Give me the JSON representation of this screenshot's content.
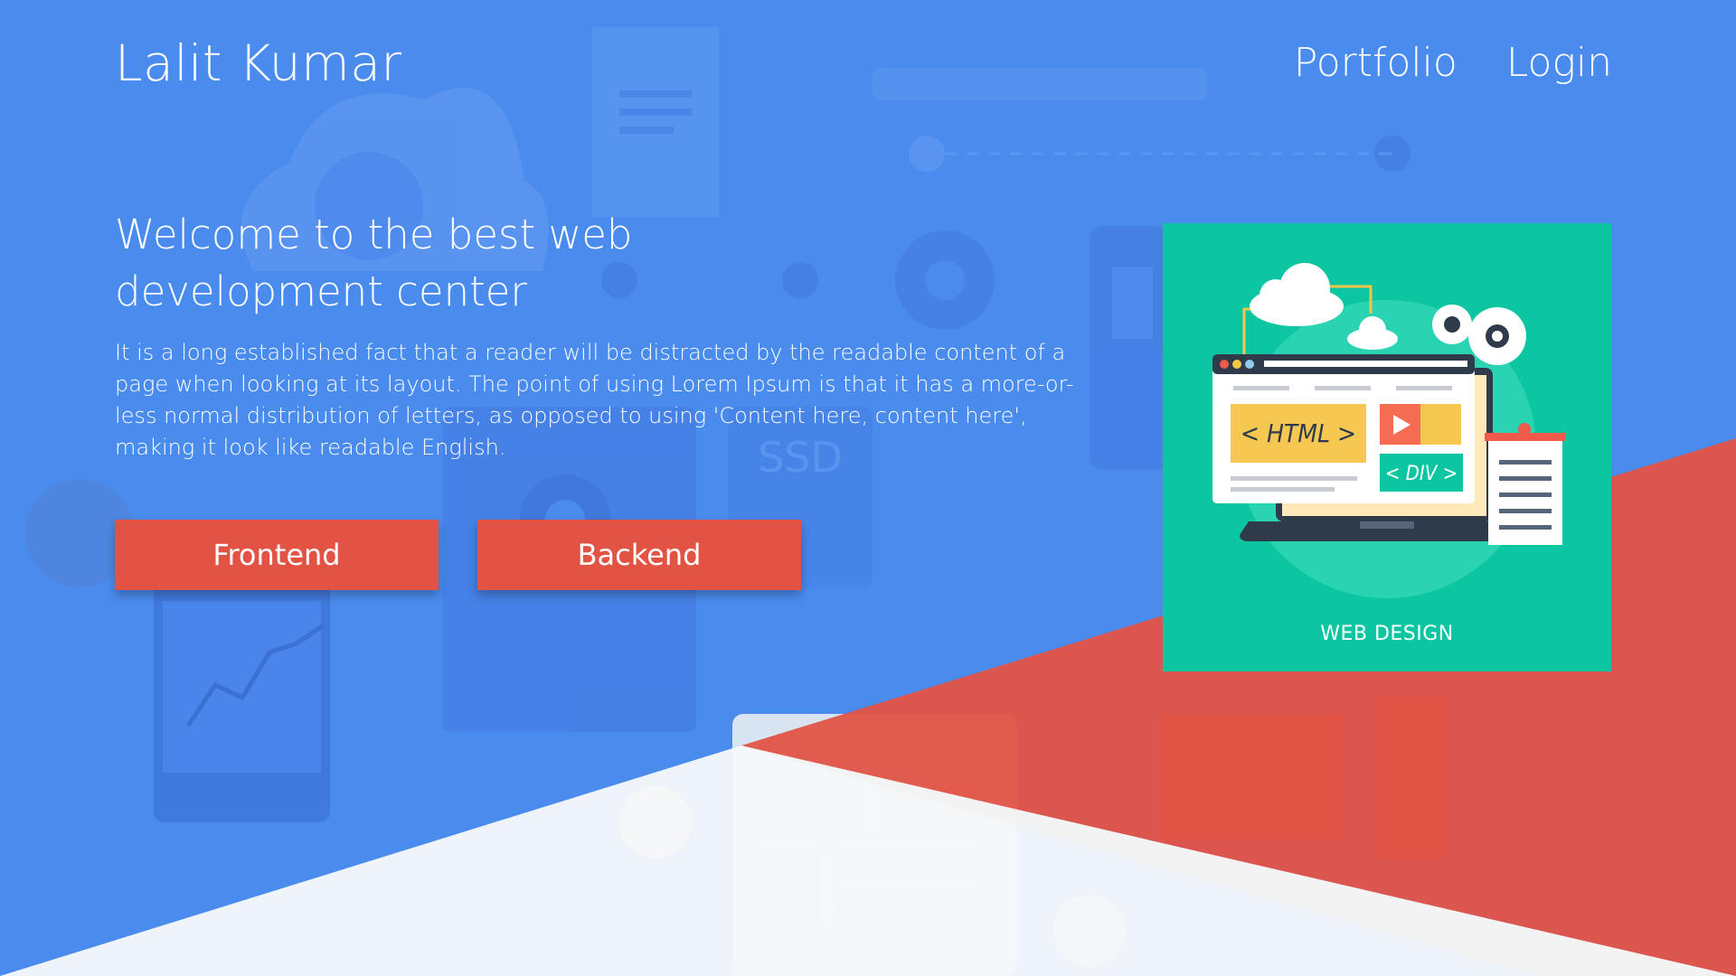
{
  "nav": {
    "brand": "Lalit Kumar",
    "links": [
      {
        "label": "Portfolio"
      },
      {
        "label": "Login"
      }
    ]
  },
  "hero": {
    "title": "Welcome to the best web development center",
    "text": "It is a long established fact that a reader will be distracted by the readable content of a page when looking at its layout. The point of using Lorem Ipsum is that it has a more-or-less normal distribution of letters, as opposed to using 'Content here, content here', making it look like readable English.",
    "buttons": [
      {
        "label": "Frontend"
      },
      {
        "label": "Backend"
      }
    ]
  },
  "card": {
    "label": "WEB DESIGN",
    "html_tag": "< HTML >",
    "div_tag": "< DIV >"
  },
  "background": {
    "ssd_label": "SSD"
  },
  "colors": {
    "primary_blue": "#4a8bee",
    "accent_red": "#e25344",
    "card_teal": "#0cc6a2",
    "light": "#f5f8fa"
  }
}
